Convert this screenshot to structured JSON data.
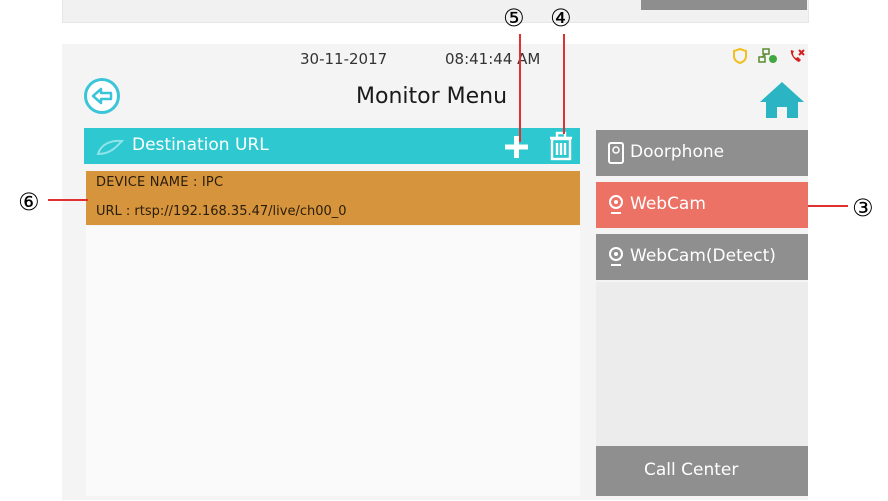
{
  "status_bar": {
    "date": "30-11-2017",
    "time": "08:41:44",
    "ampm": "AM"
  },
  "header": {
    "title": "Monitor Menu"
  },
  "destination": {
    "label": "Destination URL",
    "items": [
      {
        "device_name": "DEVICE NAME : IPC",
        "url": "URL : rtsp://192.168.35.47/live/ch00_0"
      }
    ]
  },
  "side_menu": {
    "items": [
      {
        "label": "Doorphone",
        "selected": false,
        "icon": "doorphone-icon"
      },
      {
        "label": "WebCam",
        "selected": true,
        "icon": "webcam-icon"
      },
      {
        "label": "WebCam(Detect)",
        "selected": false,
        "icon": "webcam-icon"
      }
    ],
    "call_center": "Call Center"
  },
  "callouts": {
    "c5": "⑤",
    "c4": "④",
    "c6": "⑥",
    "c3": "③"
  },
  "colors": {
    "accent": "#2ec8d0",
    "selected": "#ec7266",
    "list_item": "#d6943d",
    "side_button": "#8f8f8f"
  }
}
